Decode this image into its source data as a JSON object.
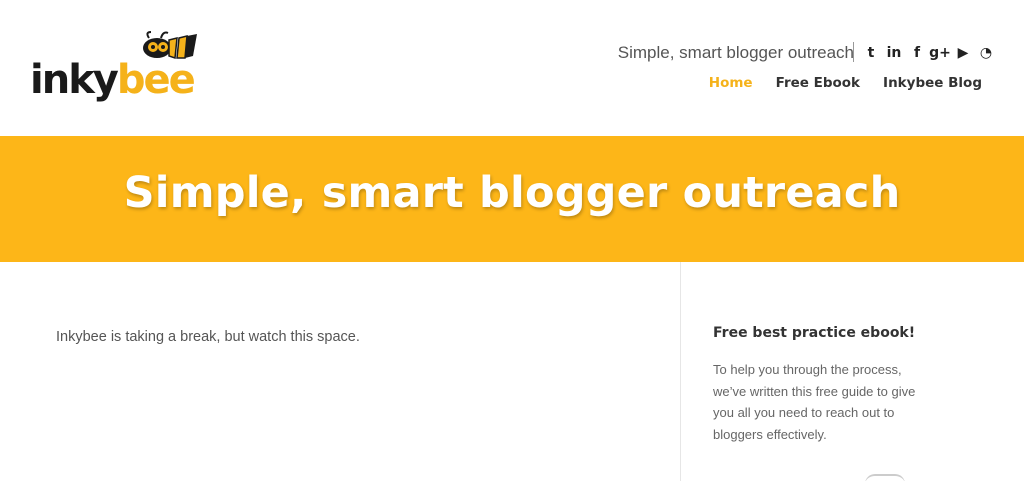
{
  "logo": {
    "part1": "inky",
    "part2": "bee",
    "accent": "#f5b21a"
  },
  "header": {
    "tagline": "Simple, smart blogger outreach",
    "social": [
      {
        "name": "twitter-icon",
        "glyph": "t"
      },
      {
        "name": "linkedin-icon",
        "glyph": "in"
      },
      {
        "name": "facebook-icon",
        "glyph": "f"
      },
      {
        "name": "google-plus-icon",
        "glyph": "g+"
      },
      {
        "name": "youtube-icon",
        "glyph": "▶"
      },
      {
        "name": "rss-icon",
        "glyph": "◔"
      }
    ]
  },
  "nav": {
    "items": [
      {
        "label": "Home",
        "active": true
      },
      {
        "label": "Free Ebook",
        "active": false
      },
      {
        "label": "Inkybee Blog",
        "active": false
      }
    ]
  },
  "banner": {
    "title": "Simple, smart blogger outreach",
    "color": "#fdb618"
  },
  "main": {
    "text": "Inkybee is taking a break, but watch this space."
  },
  "sidebar": {
    "title": "Free best practice ebook!",
    "body_lines": [
      "To help you through the process,",
      "we’ve written this free guide to give",
      "you all you need to reach out to",
      "bloggers effectively."
    ]
  }
}
